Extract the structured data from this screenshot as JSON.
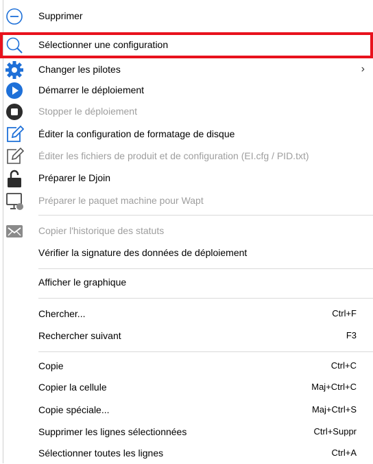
{
  "colors": {
    "highlight": "#e8121d",
    "icon_blue": "#1e70d8",
    "icon_dark": "#2c2c2c",
    "icon_grey": "#8a8a8a",
    "disabled_text": "#9e9e9e"
  },
  "menu": {
    "items": [
      {
        "label": "Supprimer",
        "icon": "minus-circle-icon",
        "enabled": true
      },
      {
        "label": "Sélectionner une configuration",
        "icon": "search-icon",
        "enabled": true,
        "highlighted": true
      },
      {
        "label": "Changer les pilotes",
        "icon": "gear-icon",
        "enabled": true,
        "submenu": true,
        "submenu_glyph": "›"
      },
      {
        "label": "Démarrer le déploiement",
        "icon": "play-icon",
        "enabled": true
      },
      {
        "label": "Stopper le déploiement",
        "icon": "stop-icon",
        "enabled": false
      },
      {
        "label": "Éditer la configuration de formatage de disque",
        "icon": "edit-icon",
        "enabled": true
      },
      {
        "label": "Éditer les fichiers de produit et de configuration (EI.cfg / PID.txt)",
        "icon": "edit-outline-icon",
        "enabled": false
      },
      {
        "label": "Préparer le Djoin",
        "icon": "unlock-icon",
        "enabled": true
      },
      {
        "label": "Préparer le paquet machine pour Wapt",
        "icon": "computer-icon",
        "enabled": false
      },
      {
        "label": "Copier l'historique des statuts",
        "icon": "mail-icon",
        "enabled": false
      },
      {
        "label": "Vérifier la signature des données de déploiement",
        "enabled": true
      },
      {
        "label": "Afficher le graphique",
        "enabled": true
      },
      {
        "label": "Chercher...",
        "shortcut": "Ctrl+F",
        "enabled": true
      },
      {
        "label": "Rechercher suivant",
        "shortcut": "F3",
        "enabled": true
      },
      {
        "label": "Copie",
        "shortcut": "Ctrl+C",
        "enabled": true
      },
      {
        "label": "Copier la cellule",
        "shortcut": "Maj+Ctrl+C",
        "enabled": true
      },
      {
        "label": "Copie spéciale...",
        "shortcut": "Maj+Ctrl+S",
        "enabled": true
      },
      {
        "label": "Supprimer les lignes sélectionnées",
        "shortcut": "Ctrl+Suppr",
        "enabled": true
      },
      {
        "label": "Sélectionner toutes les lignes",
        "shortcut": "Ctrl+A",
        "enabled": true
      }
    ]
  }
}
